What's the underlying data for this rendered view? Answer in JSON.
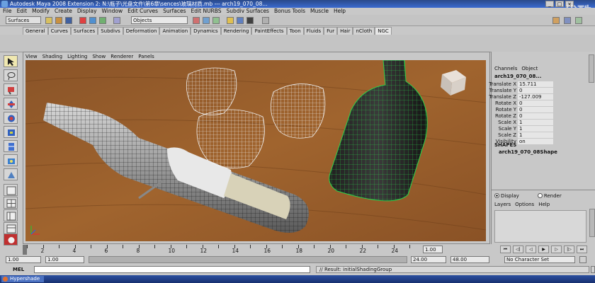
{
  "window": {
    "title": "Autodesk Maya 2008 Extension 2: N:\\瓶子\\光盘文件\\第6章\\sences\\玻璃材质.mb  ---  arch19_070_08...",
    "watermark": "优酷",
    "controls": [
      "_",
      "□",
      "×"
    ]
  },
  "menubar": {
    "items": [
      "File",
      "Edit",
      "Modify",
      "Create",
      "Display",
      "Window",
      "Edit Curves",
      "Surfaces",
      "Edit NURBS",
      "Subdiv Surfaces",
      "Bonus Tools",
      "Muscle",
      "Help"
    ]
  },
  "statusline": {
    "mode": "Surfaces",
    "selection_field": "Objects"
  },
  "shelf": {
    "tabs": [
      "General",
      "Curves",
      "Surfaces",
      "Subdivs",
      "Deformation",
      "Animation",
      "Dynamics",
      "Rendering",
      "PaintEffects",
      "Toon",
      "Fluids",
      "Fur",
      "Hair",
      "nCloth",
      "NGC"
    ],
    "active_tab": "NGC"
  },
  "viewport": {
    "menu": [
      "View",
      "Shading",
      "Lighting",
      "Show",
      "Renderer",
      "Panels"
    ],
    "background_color": "#7a4a25",
    "wire_color": "#1a1a1a",
    "selected_wire_color": "#2bd24a"
  },
  "channelbox": {
    "menu": [
      "Channels",
      "Object"
    ],
    "object_name": "arch19_070_08...",
    "channels": [
      {
        "label": "Translate X",
        "value": "15.711"
      },
      {
        "label": "Translate Y",
        "value": "0"
      },
      {
        "label": "Translate Z",
        "value": "-127.009"
      },
      {
        "label": "Rotate X",
        "value": "0"
      },
      {
        "label": "Rotate Y",
        "value": "0"
      },
      {
        "label": "Rotate Z",
        "value": "0"
      },
      {
        "label": "Scale X",
        "value": "1"
      },
      {
        "label": "Scale Y",
        "value": "1"
      },
      {
        "label": "Scale Z",
        "value": "1"
      },
      {
        "label": "Visibility",
        "value": "on"
      }
    ],
    "shapes_header": "SHAPES",
    "shape_name": "arch19_070_08Shape"
  },
  "layers": {
    "modes": [
      "Display",
      "Render"
    ],
    "active_mode": "Display",
    "menu": [
      "Layers",
      "Options",
      "Help"
    ]
  },
  "timeline": {
    "ticks": [
      "2",
      "4",
      "6",
      "8",
      "10",
      "12",
      "14",
      "16",
      "18",
      "20",
      "22",
      "24"
    ],
    "current_time": "1.00"
  },
  "range": {
    "start_field": "1.00",
    "range_start": "1.00",
    "range_end": "24.00",
    "end_field": "48.00",
    "character_set": "No Character Set"
  },
  "command_line": {
    "label": "MEL",
    "result": "// Result: initialShadingGroup"
  },
  "taskbar": {
    "task": "Hypershade"
  }
}
